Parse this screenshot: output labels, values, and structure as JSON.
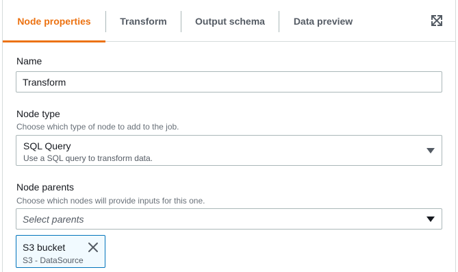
{
  "tabs": {
    "items": [
      {
        "label": "Node properties"
      },
      {
        "label": "Transform"
      },
      {
        "label": "Output schema"
      },
      {
        "label": "Data preview"
      }
    ],
    "active_index": 0,
    "expand_icon": "expand-icon"
  },
  "name_field": {
    "label": "Name",
    "value": "Transform"
  },
  "node_type": {
    "label": "Node type",
    "description": "Choose which type of node to add to the job.",
    "selected_label": "SQL Query",
    "selected_description": "Use a SQL query to transform data.",
    "icon": "caret-down-icon"
  },
  "node_parents": {
    "label": "Node parents",
    "description": "Choose which nodes will provide inputs for this one.",
    "placeholder": "Select parents",
    "icon": "caret-down-icon",
    "tokens": [
      {
        "label": "S3 bucket",
        "sublabel": "S3 - DataSource",
        "remove_icon": "close-icon"
      }
    ]
  },
  "colors": {
    "accent": "#ec7211",
    "token_border": "#0073bb",
    "token_bg": "#f1faff",
    "border": "#aab7b8",
    "text": "#16191f",
    "muted": "#687078"
  }
}
